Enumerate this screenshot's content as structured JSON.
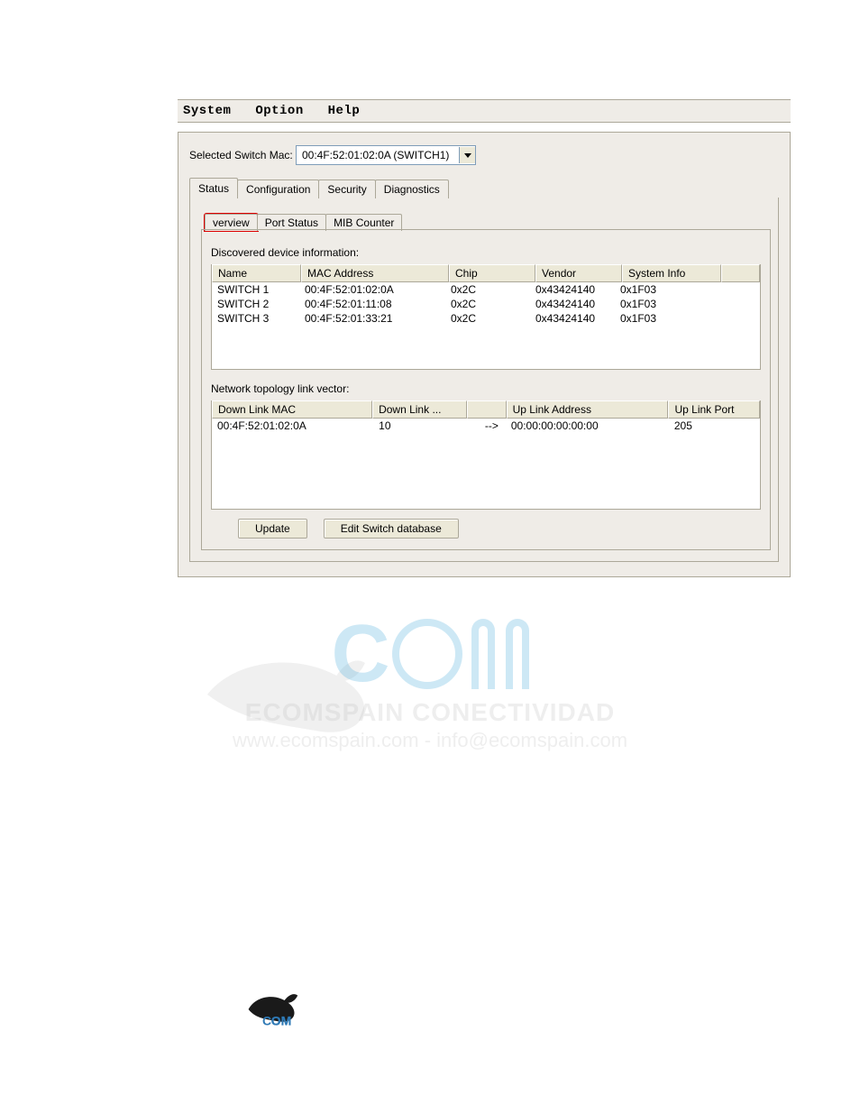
{
  "menubar": {
    "system": "System",
    "option": "Option",
    "help": "Help"
  },
  "selector": {
    "label": "Selected Switch Mac:",
    "value": "00:4F:52:01:02:0A (SWITCH1)"
  },
  "tabs": {
    "status": "Status",
    "configuration": "Configuration",
    "security": "Security",
    "diagnostics": "Diagnostics"
  },
  "subtabs": {
    "overview": "verview",
    "portstatus": "Port Status",
    "mibcounter": "MIB Counter"
  },
  "device_section_label": "Discovered device information:",
  "device_headers": {
    "name": "Name",
    "mac": "MAC Address",
    "chip": "Chip",
    "vendor": "Vendor",
    "sysinfo": "System Info"
  },
  "devices": [
    {
      "name": "SWITCH 1",
      "mac": "00:4F:52:01:02:0A",
      "chip": "0x2C",
      "vendor": "0x43424140",
      "sysinfo": "0x1F03"
    },
    {
      "name": "SWITCH 2",
      "mac": "00:4F:52:01:11:08",
      "chip": "0x2C",
      "vendor": "0x43424140",
      "sysinfo": "0x1F03"
    },
    {
      "name": "SWITCH 3",
      "mac": "00:4F:52:01:33:21",
      "chip": "0x2C",
      "vendor": "0x43424140",
      "sysinfo": "0x1F03"
    }
  ],
  "topology_section_label": "Network topology link vector:",
  "topology_headers": {
    "dlmac": "Down Link MAC",
    "dl": "Down Link ...",
    "arrow": "",
    "uladdr": "Up Link Address",
    "ulport": "Up Link Port"
  },
  "topology": [
    {
      "dlmac": "00:4F:52:01:02:0A",
      "dl": "10",
      "arrow": "-->",
      "uladdr": "00:00:00:00:00:00",
      "ulport": "205"
    }
  ],
  "buttons": {
    "update": "Update",
    "editdb": "Edit Switch database"
  },
  "watermark": {
    "brand": "ECOMSPAIN CONECTIVIDAD",
    "url": "www.ecomspain.com - info@ecomspain.com"
  }
}
